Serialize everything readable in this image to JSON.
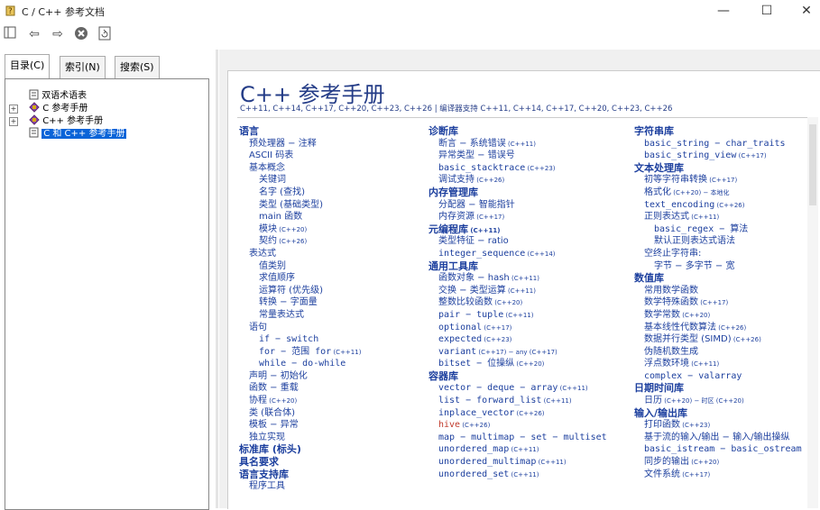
{
  "window": {
    "title": "C / C++ 参考文档",
    "minimize": "—",
    "maximize": "☐",
    "close": "✕"
  },
  "tabs": [
    "目录(C)",
    "索引(N)",
    "搜索(S)"
  ],
  "tree": {
    "items": [
      "双语术语表",
      "C 参考手册",
      "C++ 参考手册",
      "C 和 C++ 参考手册"
    ],
    "selected": "C 和 C++ 参考手册"
  },
  "page": {
    "title": "C++ 参考手册",
    "versions": "C++11, C++14, C++17, C++20, C++23, C++26 | 编译器支持 C++11, C++14, C++17, C++20, C++23, C++26"
  },
  "col1": [
    {
      "t": "语言",
      "s": "hd",
      "i": 0
    },
    {
      "t": "预处理器 − 注释",
      "i": 1
    },
    {
      "t": "ASCII 码表",
      "i": 1
    },
    {
      "t": "基本概念",
      "i": 1
    },
    {
      "t": "关键词",
      "i": 2
    },
    {
      "t": "名字 (查找)",
      "i": 2
    },
    {
      "t": "类型 (基础类型)",
      "i": 2
    },
    {
      "t": "main 函数",
      "i": 2
    },
    {
      "t": "模块",
      "v": "(C++20)",
      "i": 2
    },
    {
      "t": "契约",
      "v": "(C++26)",
      "i": 2
    },
    {
      "t": "表达式",
      "i": 1
    },
    {
      "t": "值类别",
      "i": 2
    },
    {
      "t": "求值顺序",
      "i": 2
    },
    {
      "t": "运算符 (优先级)",
      "i": 2
    },
    {
      "t": "转换 − 字面量",
      "i": 2
    },
    {
      "t": "常量表达式",
      "i": 2
    },
    {
      "t": "语句",
      "i": 1
    },
    {
      "t": "if − switch",
      "m": true,
      "i": 2
    },
    {
      "t": "for − 范围 for",
      "v": "(C++11)",
      "m": true,
      "i": 2
    },
    {
      "t": "while − do-while",
      "m": true,
      "i": 2
    },
    {
      "t": "声明 − 初始化",
      "i": 1
    },
    {
      "t": "函数 − 重载",
      "i": 1
    },
    {
      "t": "协程",
      "v": "(C++20)",
      "i": 1
    },
    {
      "t": "类 (联合体)",
      "i": 1
    },
    {
      "t": "模板 − 异常",
      "i": 1
    },
    {
      "t": "独立实现",
      "i": 1
    },
    {
      "t": "标准库 (标头)",
      "s": "hd",
      "i": 0
    },
    {
      "t": "具名要求",
      "s": "hd",
      "i": 0
    },
    {
      "t": "语言支持库",
      "s": "hd",
      "i": 0
    },
    {
      "t": "程序工具",
      "i": 1
    }
  ],
  "col2": [
    {
      "t": "诊断库",
      "s": "hd",
      "i": 0
    },
    {
      "t": "断言 − 系统错误",
      "v": "(C++11)",
      "i": 1
    },
    {
      "t": "异常类型 − 错误号",
      "i": 1
    },
    {
      "t": "basic_stacktrace",
      "v": "(C++23)",
      "m": true,
      "i": 1
    },
    {
      "t": "调试支持",
      "v": "(C++26)",
      "i": 1
    },
    {
      "t": "内存管理库",
      "s": "hd",
      "i": 0
    },
    {
      "t": "分配器 − 智能指针",
      "i": 1
    },
    {
      "t": "内存资源",
      "v": "(C++17)",
      "i": 1
    },
    {
      "t": "元编程库",
      "v": "(C++11)",
      "s": "hd",
      "i": 0
    },
    {
      "t": "类型特征 − ratio",
      "i": 1
    },
    {
      "t": "integer_sequence",
      "v": "(C++14)",
      "m": true,
      "i": 1
    },
    {
      "t": "通用工具库",
      "s": "hd",
      "i": 0
    },
    {
      "t": "函数对象 − hash",
      "v": "(C++11)",
      "i": 1
    },
    {
      "t": "交换 − 类型运算",
      "v": "(C++11)",
      "i": 1
    },
    {
      "t": "整数比较函数",
      "v": "(C++20)",
      "i": 1
    },
    {
      "t": "pair − tuple",
      "v": "(C++11)",
      "m": true,
      "i": 1
    },
    {
      "t": "optional",
      "v": "(C++17)",
      "m": true,
      "i": 1
    },
    {
      "t": "expected",
      "v": "(C++23)",
      "m": true,
      "i": 1
    },
    {
      "t": "variant",
      "v": "(C++17) − any (C++17)",
      "m": true,
      "i": 1
    },
    {
      "t": "bitset − 位操纵",
      "v": "(C++20)",
      "m": true,
      "i": 1
    },
    {
      "t": "容器库",
      "s": "hd",
      "i": 0
    },
    {
      "t": "vector − deque − array",
      "v": "(C++11)",
      "m": true,
      "i": 1
    },
    {
      "t": "list − forward_list",
      "v": "(C++11)",
      "m": true,
      "i": 1
    },
    {
      "t": "inplace_vector",
      "v": "(C++26)",
      "m": true,
      "i": 1
    },
    {
      "t": "hive",
      "v": "(C++26)",
      "m": true,
      "red": true,
      "i": 1
    },
    {
      "t": "map − multimap − set − multiset",
      "m": true,
      "i": 1
    },
    {
      "t": "unordered_map",
      "v": "(C++11)",
      "m": true,
      "i": 1
    },
    {
      "t": "unordered_multimap",
      "v": "(C++11)",
      "m": true,
      "i": 1
    },
    {
      "t": "unordered_set",
      "v": "(C++11)",
      "m": true,
      "i": 1
    }
  ],
  "col3": [
    {
      "t": "字符串库",
      "s": "hd",
      "i": 0
    },
    {
      "t": "basic_string − char_traits",
      "m": true,
      "i": 1
    },
    {
      "t": "basic_string_view",
      "v": "(C++17)",
      "m": true,
      "i": 1
    },
    {
      "t": "文本处理库",
      "s": "hd",
      "i": 0
    },
    {
      "t": "初等字符串转换",
      "v": "(C++17)",
      "i": 1
    },
    {
      "t": "格式化",
      "v": "(C++20) − 本地化",
      "i": 1
    },
    {
      "t": "text_encoding",
      "v": "(C++26)",
      "m": true,
      "i": 1
    },
    {
      "t": "正则表达式",
      "v": "(C++11)",
      "i": 1
    },
    {
      "t": "basic_regex − 算法",
      "m": true,
      "i": 2
    },
    {
      "t": "默认正则表达式语法",
      "i": 2
    },
    {
      "t": "空终止字符串:",
      "i": 1
    },
    {
      "t": "字节 − 多字节 − 宽",
      "i": 2
    },
    {
      "t": "数值库",
      "s": "hd",
      "i": 0
    },
    {
      "t": "常用数学函数",
      "i": 1
    },
    {
      "t": "数学特殊函数",
      "v": "(C++17)",
      "i": 1
    },
    {
      "t": "数学常数",
      "v": "(C++20)",
      "i": 1
    },
    {
      "t": "基本线性代数算法",
      "v": "(C++26)",
      "i": 1
    },
    {
      "t": "数据并行类型 (SIMD)",
      "v": "(C++26)",
      "i": 1
    },
    {
      "t": "伪随机数生成",
      "i": 1
    },
    {
      "t": "浮点数环境",
      "v": "(C++11)",
      "i": 1
    },
    {
      "t": "complex − valarray",
      "m": true,
      "i": 1
    },
    {
      "t": "日期时间库",
      "s": "hd",
      "i": 0
    },
    {
      "t": "日历",
      "v": "(C++20) − 时区 (C++20)",
      "i": 1
    },
    {
      "t": "输入/输出库",
      "s": "hd",
      "i": 0
    },
    {
      "t": "打印函数",
      "v": "(C++23)",
      "i": 1
    },
    {
      "t": "基于流的输入/输出 − 输入/输出操纵",
      "i": 1
    },
    {
      "t": "basic_istream − basic_ostream",
      "m": true,
      "i": 1
    },
    {
      "t": "同步的输出",
      "v": "(C++20)",
      "i": 1
    },
    {
      "t": "文件系统",
      "v": "(C++17)",
      "i": 1
    }
  ]
}
